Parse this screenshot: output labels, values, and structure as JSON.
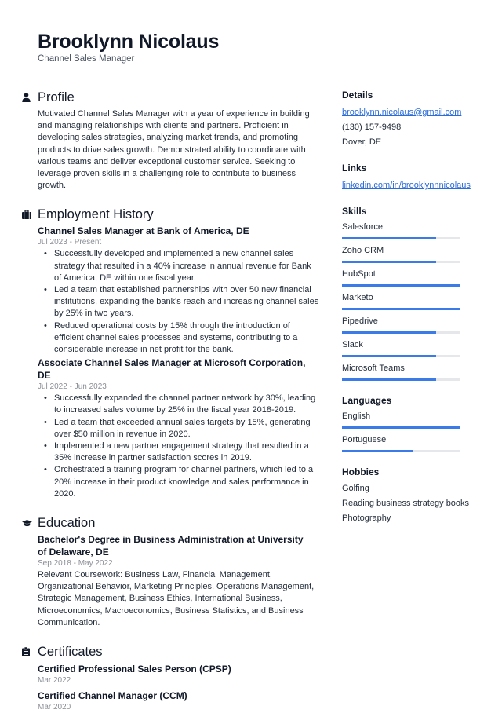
{
  "header": {
    "name": "Brooklynn Nicolaus",
    "title": "Channel Sales Manager"
  },
  "profile": {
    "heading": "Profile",
    "icon": "user-icon",
    "text": "Motivated Channel Sales Manager with a year of experience in building and managing relationships with clients and partners. Proficient in developing sales strategies, analyzing market trends, and promoting products to drive sales growth. Demonstrated ability to coordinate with various teams and deliver exceptional customer service. Seeking to leverage proven skills in a challenging role to contribute to business growth."
  },
  "employment": {
    "heading": "Employment History",
    "icon": "briefcase-icon",
    "jobs": [
      {
        "title": "Channel Sales Manager at Bank of America, DE",
        "dates": "Jul 2023 - Present",
        "bullets": [
          "Successfully developed and implemented a new channel sales strategy that resulted in a 40% increase in annual revenue for Bank of America, DE within one fiscal year.",
          "Led a team that established partnerships with over 50 new financial institutions, expanding the bank's reach and increasing channel sales by 25% in two years.",
          "Reduced operational costs by 15% through the introduction of efficient channel sales processes and systems, contributing to a considerable increase in net profit for the bank."
        ]
      },
      {
        "title": "Associate Channel Sales Manager at Microsoft Corporation, DE",
        "dates": "Jul 2022 - Jun 2023",
        "bullets": [
          "Successfully expanded the channel partner network by 30%, leading to increased sales volume by 25% in the fiscal year 2018-2019.",
          "Led a team that exceeded annual sales targets by 15%, generating over $50 million in revenue in 2020.",
          "Implemented a new partner engagement strategy that resulted in a 35% increase in partner satisfaction scores in 2019.",
          "Orchestrated a training program for channel partners, which led to a 20% increase in their product knowledge and sales performance in 2020."
        ]
      }
    ]
  },
  "education": {
    "heading": "Education",
    "icon": "graduation-cap-icon",
    "items": [
      {
        "title": "Bachelor's Degree in Business Administration at University of Delaware, DE",
        "dates": "Sep 2018 - May 2022",
        "description": "Relevant Coursework: Business Law, Financial Management, Organizational Behavior, Marketing Principles, Operations Management, Strategic Management, Business Ethics, International Business, Microeconomics, Macroeconomics, Business Statistics, and Business Communication."
      }
    ]
  },
  "certificates": {
    "heading": "Certificates",
    "icon": "clipboard-icon",
    "items": [
      {
        "title": "Certified Professional Sales Person (CPSP)",
        "date": "Mar 2022"
      },
      {
        "title": "Certified Channel Manager (CCM)",
        "date": "Mar 2020"
      }
    ]
  },
  "sidebar": {
    "details": {
      "heading": "Details",
      "email": "brooklynn.nicolaus@gmail.com",
      "phone": "(130) 157-9498",
      "location": "Dover, DE"
    },
    "links": {
      "heading": "Links",
      "items": [
        "linkedin.com/in/brooklynnnicolaus"
      ]
    },
    "skills": {
      "heading": "Skills",
      "items": [
        {
          "name": "Salesforce",
          "level": 0.8
        },
        {
          "name": "Zoho CRM",
          "level": 0.8
        },
        {
          "name": "HubSpot",
          "level": 1.0
        },
        {
          "name": "Marketo",
          "level": 1.0
        },
        {
          "name": "Pipedrive",
          "level": 0.8
        },
        {
          "name": "Slack",
          "level": 0.8
        },
        {
          "name": "Microsoft Teams",
          "level": 0.8
        }
      ]
    },
    "languages": {
      "heading": "Languages",
      "items": [
        {
          "name": "English",
          "level": 1.0
        },
        {
          "name": "Portuguese",
          "level": 0.6
        }
      ]
    },
    "hobbies": {
      "heading": "Hobbies",
      "items": [
        "Golfing",
        "Reading business strategy books",
        "Photography"
      ]
    }
  },
  "colors": {
    "accent": "#3b7be8",
    "link": "#2b6cd8",
    "bar_track": "#e5e7eb",
    "muted": "#8b8f96"
  }
}
